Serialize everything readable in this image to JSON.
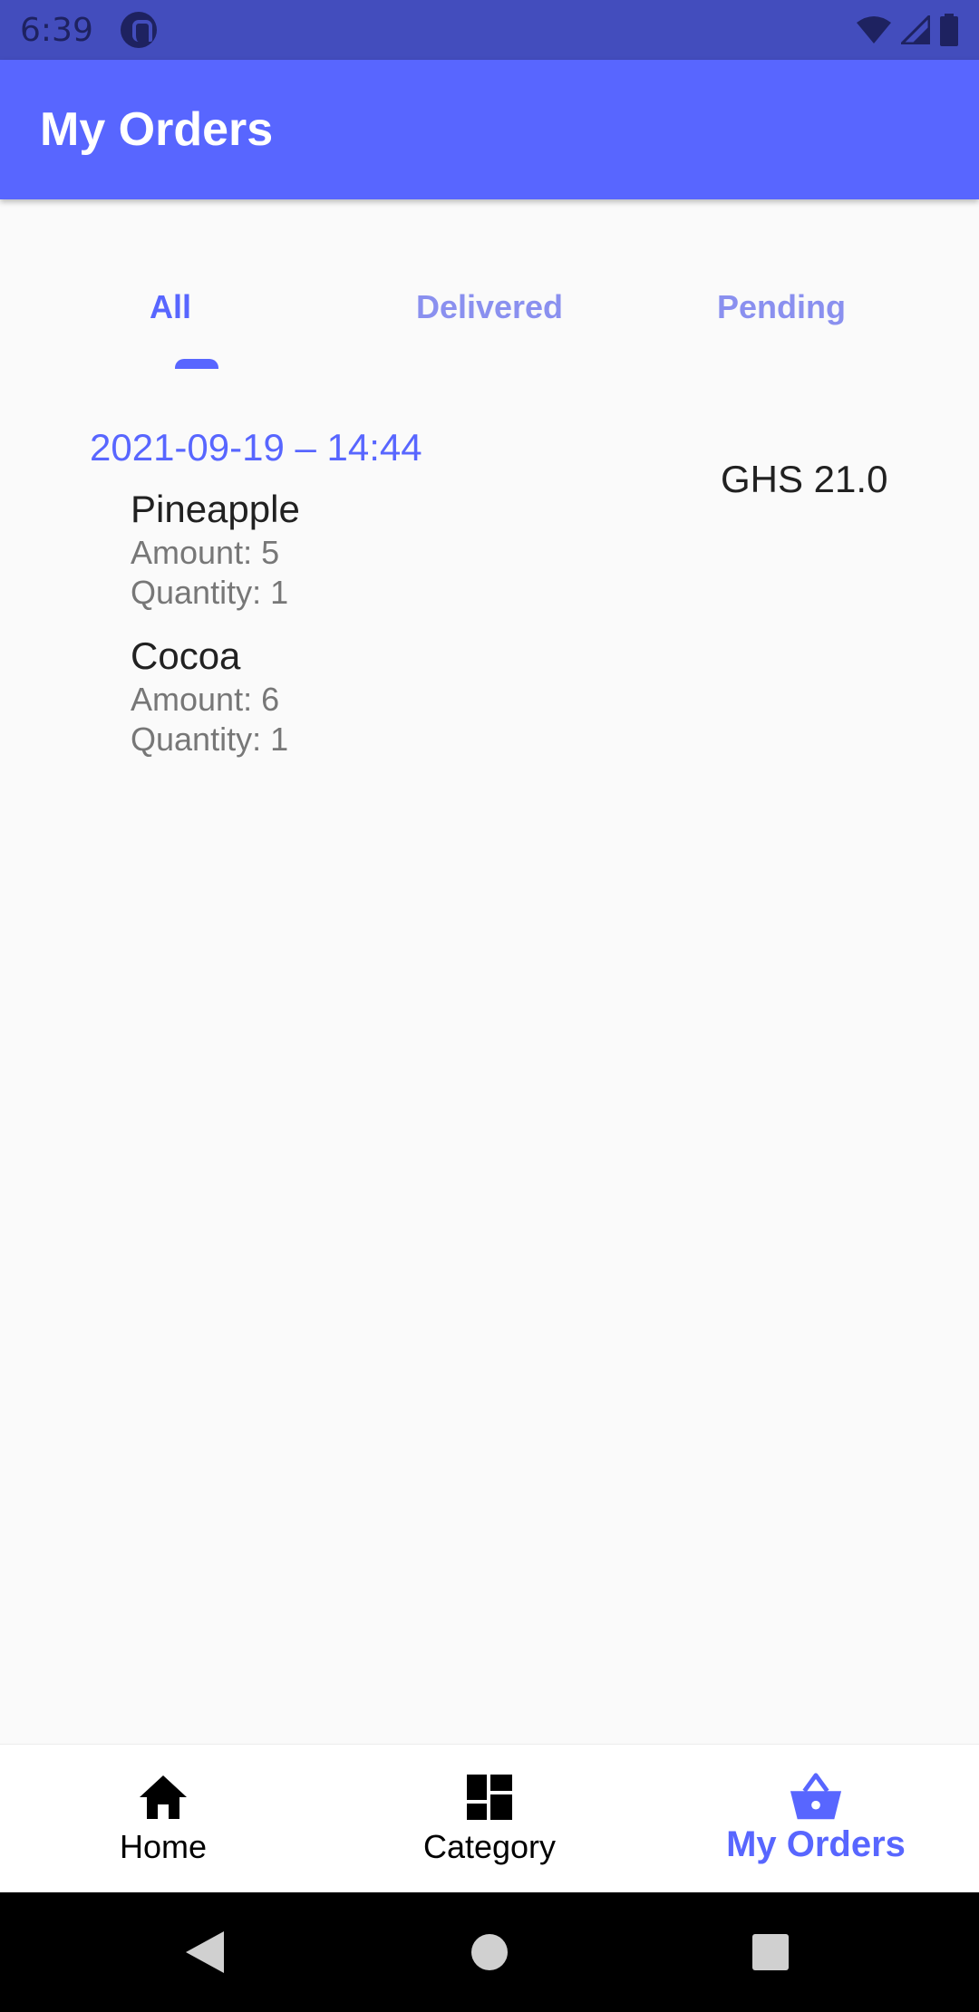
{
  "status_bar": {
    "time": "6:39"
  },
  "app_bar": {
    "title": "My Orders"
  },
  "tabs": [
    {
      "label": "All",
      "active": true
    },
    {
      "label": "Delivered",
      "active": false
    },
    {
      "label": "Pending",
      "active": false
    }
  ],
  "order": {
    "date": "2021-09-19 – 14:44",
    "total": "GHS 21.0",
    "items": [
      {
        "name": "Pineapple",
        "amount": "Amount: 5",
        "quantity": "Quantity: 1"
      },
      {
        "name": "Cocoa",
        "amount": "Amount: 6",
        "quantity": "Quantity: 1"
      }
    ]
  },
  "bottom_nav": [
    {
      "label": "Home",
      "icon": "home-icon",
      "active": false
    },
    {
      "label": "Category",
      "icon": "dashboard-icon",
      "active": false
    },
    {
      "label": "My Orders",
      "icon": "basket-icon",
      "active": true
    }
  ],
  "colors": {
    "primary": "#5866ff",
    "status_bar": "#434dbd",
    "inactive_tab": "#8a90ef"
  }
}
